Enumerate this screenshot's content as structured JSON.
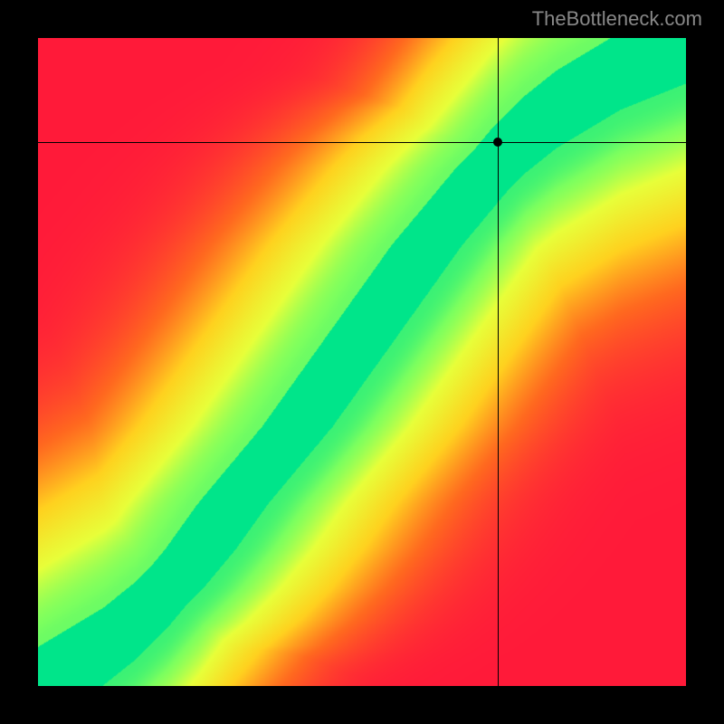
{
  "watermark": "TheBottleneck.com",
  "chart_data": {
    "type": "heatmap",
    "title": "",
    "xlabel": "",
    "ylabel": "",
    "xlim": [
      0,
      100
    ],
    "ylim": [
      0,
      100
    ],
    "grid": false,
    "legend": false,
    "crosshair": {
      "x": 71,
      "y": 84
    },
    "marker": {
      "x": 71,
      "y": 84
    },
    "colorscale": [
      {
        "t": 0.0,
        "color": "#ff1a3a"
      },
      {
        "t": 0.25,
        "color": "#ff6a1f"
      },
      {
        "t": 0.5,
        "color": "#ffd21f"
      },
      {
        "t": 0.75,
        "color": "#e8ff3a"
      },
      {
        "t": 0.9,
        "color": "#7aff60"
      },
      {
        "t": 1.0,
        "color": "#00e58a"
      }
    ],
    "ridge": [
      {
        "x": 0,
        "y": 0
      },
      {
        "x": 5,
        "y": 3
      },
      {
        "x": 10,
        "y": 6
      },
      {
        "x": 15,
        "y": 10
      },
      {
        "x": 20,
        "y": 15
      },
      {
        "x": 25,
        "y": 21
      },
      {
        "x": 30,
        "y": 28
      },
      {
        "x": 35,
        "y": 34
      },
      {
        "x": 40,
        "y": 40
      },
      {
        "x": 45,
        "y": 47
      },
      {
        "x": 50,
        "y": 54
      },
      {
        "x": 55,
        "y": 61
      },
      {
        "x": 60,
        "y": 68
      },
      {
        "x": 65,
        "y": 74
      },
      {
        "x": 70,
        "y": 80
      },
      {
        "x": 75,
        "y": 85
      },
      {
        "x": 80,
        "y": 89
      },
      {
        "x": 85,
        "y": 92
      },
      {
        "x": 90,
        "y": 95
      },
      {
        "x": 95,
        "y": 97
      },
      {
        "x": 100,
        "y": 99
      }
    ],
    "ridge_width_norm": 0.06,
    "falloff_scale_norm": 0.45
  }
}
